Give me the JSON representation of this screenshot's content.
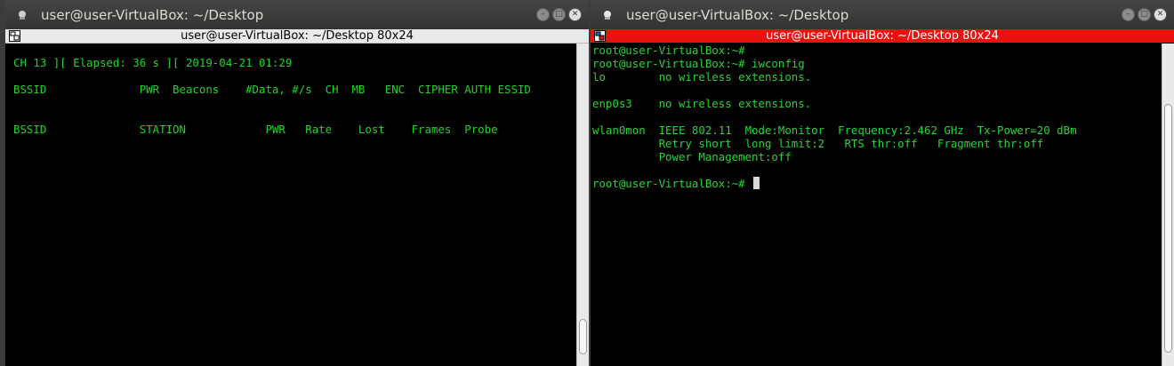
{
  "left_window": {
    "title": "user@user-VirtualBox: ~/Desktop",
    "subtitle": "user@user-VirtualBox: ~/Desktop 80x24",
    "lines": [
      "CH 13 ][ Elapsed: 36 s ][ 2019-04-21 01:29",
      "",
      "BSSID              PWR  Beacons    #Data, #/s  CH  MB   ENC  CIPHER AUTH ESSID",
      "",
      "",
      "BSSID              STATION            PWR   Rate    Lost    Frames  Probe"
    ]
  },
  "right_window": {
    "title": "user@user-VirtualBox: ~/Desktop",
    "subtitle": "user@user-VirtualBox: ~/Desktop 80x24",
    "lines": [
      "root@user-VirtualBox:~#",
      "root@user-VirtualBox:~# iwconfig",
      "lo        no wireless extensions.",
      "",
      "enp0s3    no wireless extensions.",
      "",
      "wlan0mon  IEEE 802.11  Mode:Monitor  Frequency:2.462 GHz  Tx-Power=20 dBm",
      "          Retry short  long limit:2   RTS thr:off   Fragment thr:off",
      "          Power Management:off",
      ""
    ],
    "prompt": "root@user-VirtualBox:~# "
  },
  "icons": {
    "app": "terminal-app-icon",
    "minimize": "minimize-icon",
    "maximize": "maximize-icon",
    "close": "close-icon",
    "xterm": "xterm-icon"
  },
  "colors": {
    "terminal_text": "#22d22b",
    "active_subbar": "#e8130f",
    "inactive_subbar": "#eaeaea",
    "terminal_bg": "#000000"
  }
}
